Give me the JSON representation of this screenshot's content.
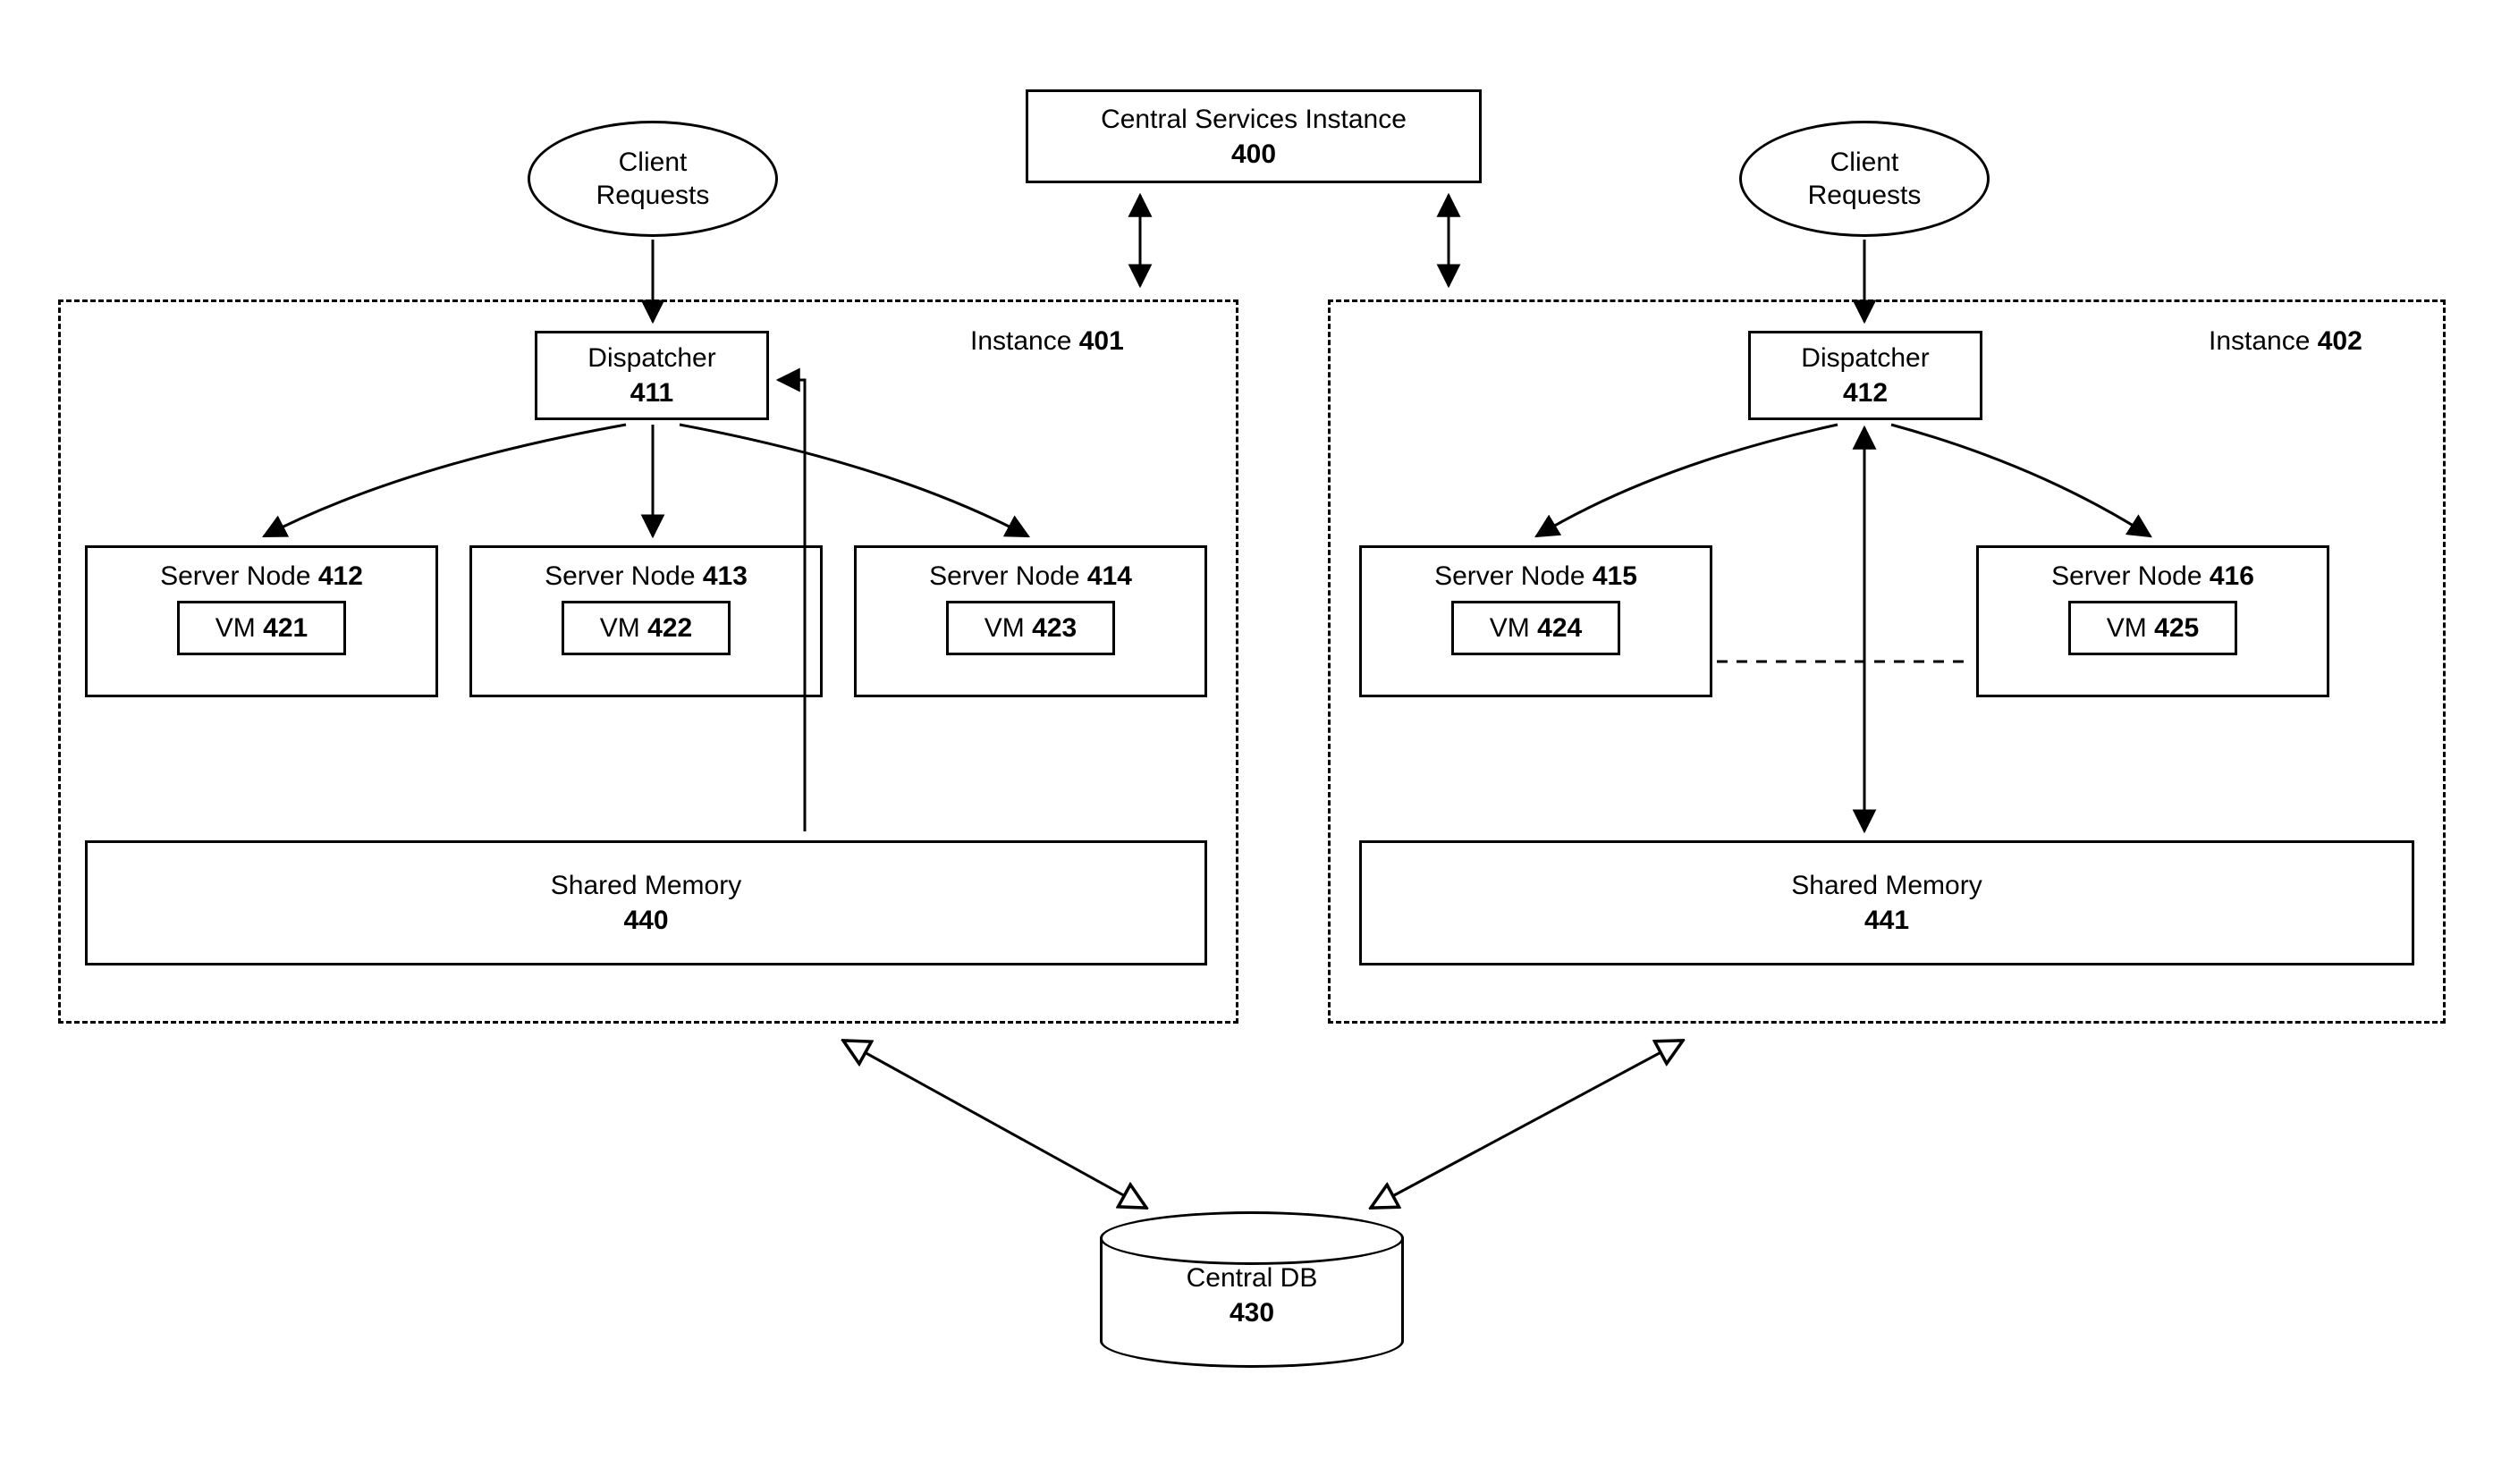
{
  "central_services": {
    "title": "Central Services Instance",
    "id": "400"
  },
  "client_requests_left": {
    "line1": "Client",
    "line2": "Requests"
  },
  "client_requests_right": {
    "line1": "Client",
    "line2": "Requests"
  },
  "instance_left": {
    "label_prefix": "Instance ",
    "id": "401"
  },
  "instance_right": {
    "label_prefix": "Instance ",
    "id": "402"
  },
  "dispatcher_left": {
    "title": "Dispatcher",
    "id": "411"
  },
  "dispatcher_right": {
    "title": "Dispatcher",
    "id": "412"
  },
  "server_nodes_left": [
    {
      "title": "Server Node ",
      "id": "412",
      "vm_prefix": "VM ",
      "vm_id": "421"
    },
    {
      "title": "Server Node ",
      "id": "413",
      "vm_prefix": "VM ",
      "vm_id": "422"
    },
    {
      "title": "Server Node ",
      "id": "414",
      "vm_prefix": "VM ",
      "vm_id": "423"
    }
  ],
  "server_nodes_right": [
    {
      "title": "Server Node ",
      "id": "415",
      "vm_prefix": "VM ",
      "vm_id": "424"
    },
    {
      "title": "Server Node ",
      "id": "416",
      "vm_prefix": "VM ",
      "vm_id": "425"
    }
  ],
  "shared_memory_left": {
    "title": "Shared Memory",
    "id": "440"
  },
  "shared_memory_right": {
    "title": "Shared Memory",
    "id": "441"
  },
  "central_db": {
    "title": "Central DB",
    "id": "430"
  }
}
